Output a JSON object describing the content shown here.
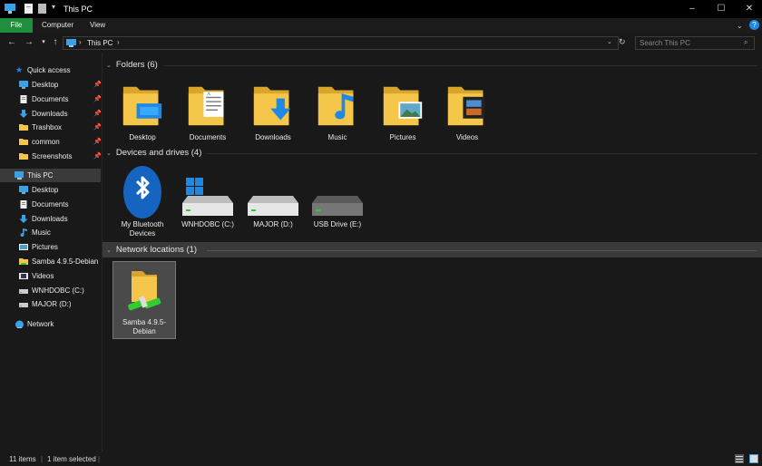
{
  "window": {
    "title": "This PC"
  },
  "ribbon": {
    "tabs": [
      "File",
      "Computer",
      "View"
    ]
  },
  "address": {
    "path": "This PC",
    "search_placeholder": "Search This PC"
  },
  "sidebar": {
    "quick_access_label": "Quick access",
    "quick_items": [
      {
        "label": "Desktop",
        "icon": "desktop-icon",
        "pinned": true
      },
      {
        "label": "Documents",
        "icon": "documents-icon",
        "pinned": true
      },
      {
        "label": "Downloads",
        "icon": "downloads-icon",
        "pinned": true
      },
      {
        "label": "Trashbox",
        "icon": "folder-icon",
        "pinned": true
      },
      {
        "label": "common",
        "icon": "folder-icon",
        "pinned": true
      },
      {
        "label": "Screenshots",
        "icon": "folder-icon",
        "pinned": true
      }
    ],
    "this_pc_label": "This PC",
    "pc_items": [
      {
        "label": "Desktop",
        "icon": "desktop-icon"
      },
      {
        "label": "Documents",
        "icon": "documents-icon"
      },
      {
        "label": "Downloads",
        "icon": "downloads-icon"
      },
      {
        "label": "Music",
        "icon": "music-icon"
      },
      {
        "label": "Pictures",
        "icon": "pictures-icon"
      },
      {
        "label": "Samba 4.9.5-Debian",
        "icon": "network-drive-icon"
      },
      {
        "label": "Videos",
        "icon": "videos-icon"
      },
      {
        "label": "WNHDOBC (C:)",
        "icon": "drive-icon"
      },
      {
        "label": "MAJOR (D:)",
        "icon": "drive-icon"
      }
    ],
    "network_label": "Network"
  },
  "groups": {
    "folders": {
      "title": "Folders (6)",
      "items": [
        "Desktop",
        "Documents",
        "Downloads",
        "Music",
        "Pictures",
        "Videos"
      ]
    },
    "devices": {
      "title": "Devices and drives (4)",
      "items": [
        "My Bluetooth Devices",
        "WNHDOBC (C:)",
        "MAJOR (D:)",
        "USB Drive (E:)"
      ]
    },
    "network": {
      "title": "Network locations (1)",
      "items": [
        "Samba 4.9.5-Debian"
      ]
    }
  },
  "status": {
    "count": "11 items",
    "selected": "1 item selected"
  },
  "colors": {
    "accent": "#1f8f3f",
    "folder": "#f4c64a",
    "blue": "#1e88e5"
  }
}
